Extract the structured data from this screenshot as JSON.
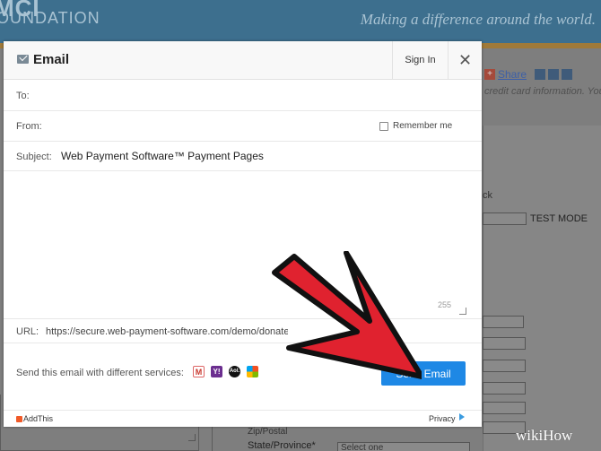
{
  "background_page": {
    "logo_top": "MCI",
    "logo_bottom": "OUNDATION",
    "tagline": "Making a difference around the world.",
    "share_label": "Share",
    "credit_text": "credit card information. You",
    "ck_text": "ck",
    "test_mode_label": "TEST MODE",
    "state_label": "State/Province*",
    "state_select_value": "Select one",
    "partial_label": "Zip/Postal"
  },
  "dialog": {
    "title": "Email",
    "sign_in_label": "Sign In",
    "close_symbol": "✕",
    "to_label": "To:",
    "to_value": "",
    "from_label": "From:",
    "from_value": "",
    "remember_label": "Remember me",
    "remember_checked": false,
    "subject_label": "Subject:",
    "subject_value": "Web Payment Software™ Payment Pages",
    "message_value": "",
    "char_count": "255",
    "url_label": "URL:",
    "url_value": "https://secure.web-payment-software.com/demo/donate",
    "services_label": "Send this email with different services:",
    "services": [
      {
        "name": "gmail-icon",
        "glyph": "M"
      },
      {
        "name": "yahoo-icon",
        "glyph": "Y!"
      },
      {
        "name": "aol-icon",
        "glyph": "Aol."
      },
      {
        "name": "outlook-icon",
        "glyph": ""
      }
    ],
    "send_button_label": "Send Email",
    "footer_brand": "AddThis",
    "footer_privacy": "Privacy"
  },
  "watermark": "wikiHow",
  "colors": {
    "header_blue": "#3d6f8e",
    "send_button": "#1e88e5",
    "arrow_red": "#e0222f"
  }
}
